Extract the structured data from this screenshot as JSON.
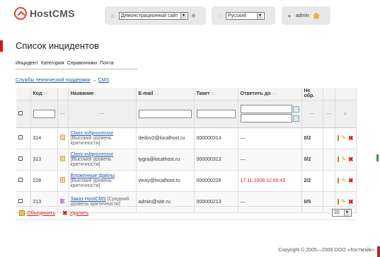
{
  "app": {
    "logo_text": "HostCMS"
  },
  "header": {
    "site_select": "Демонстрационный сайт",
    "language_select": "Русский",
    "user": "admin"
  },
  "page": {
    "title": "Список инцидентов",
    "menu": [
      "Инцидент",
      "Категория",
      "Справочники",
      "Почта"
    ],
    "breadcrumb": [
      "Службы технической поддержки",
      "→",
      "CMS"
    ]
  },
  "table": {
    "headers": {
      "code": "Код",
      "name": "Название",
      "email": "E-mail",
      "ticket": "Тикет",
      "answer_by": "Ответить до",
      "unprocessed": "Не обр."
    },
    "filter_dash": "—",
    "rows": [
      {
        "code": "314",
        "name": "Class xsltprocessor",
        "sub": "[Высокий уровень критичности]",
        "email": "dedov2@localhost.ru",
        "ticket": "000000314",
        "answer_by": "—",
        "answer_red": false,
        "unprocessed": "0/2"
      },
      {
        "code": "313",
        "name": "Class xsltprocessor",
        "sub": "[Высокий уровень критичности]",
        "email": "tygra@localhost.ru",
        "ticket": "000000313",
        "answer_by": "—",
        "answer_red": false,
        "unprocessed": "0/2"
      },
      {
        "code": "228",
        "name": "Вложенные файлы",
        "sub": "[Высокий уровень критичности]",
        "email": "vinny@localhost.ru",
        "ticket": "000000228",
        "answer_by": "17.11.2008 12:00:45",
        "answer_red": true,
        "unprocessed": "2/2"
      },
      {
        "code": "213",
        "name": "Заказ HostCMS",
        "sub": "[Средний уровень критичности]",
        "email": "admin@site.ru",
        "ticket": "000000213",
        "answer_by": "—",
        "answer_red": false,
        "unprocessed": "0/5"
      }
    ]
  },
  "footer": {
    "merge_label": "Объединить",
    "delete_label": "Удалить",
    "per_page": "20"
  },
  "copyright": "Copyright © 2005—2008 ООО «Хостмэйк»",
  "colors": {
    "accent": "#c41e1e",
    "link": "#2a56a8",
    "danger": "#d22"
  }
}
